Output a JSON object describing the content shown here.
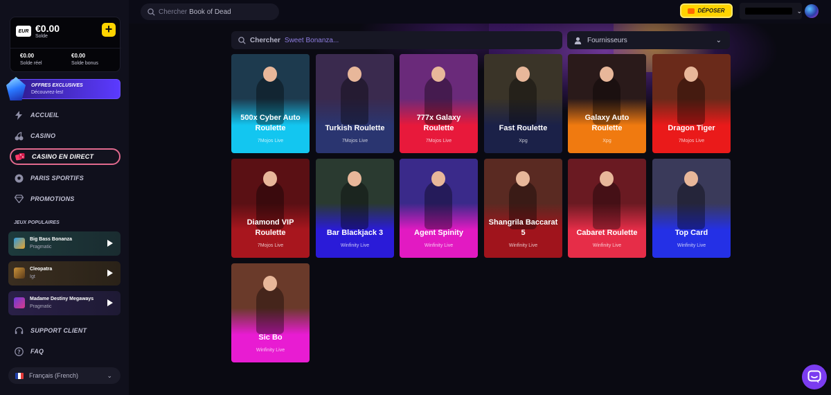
{
  "top": {
    "search_prefix": "Chercher",
    "search_hint": "Book of Dead",
    "deposit_label": "DÉPOSER"
  },
  "balance": {
    "currency": "EUR",
    "amount": "€0.00",
    "label": "Solde",
    "real_value": "€0.00",
    "real_label": "Solde réel",
    "bonus_value": "€0.00",
    "bonus_label": "Solde bonus"
  },
  "promo": {
    "title": "OFFRES EXCLUSIVES",
    "subtitle": "Découvrez-les!"
  },
  "nav": [
    {
      "label": "ACCUEIL",
      "icon": "bolt-icon"
    },
    {
      "label": "CASINO",
      "icon": "cherry-icon"
    },
    {
      "label": "CASINO EN DIRECT",
      "icon": "dice-icon",
      "active": true
    },
    {
      "label": "PARIS SPORTIFS",
      "icon": "soccer-ball-icon"
    },
    {
      "label": "PROMOTIONS",
      "icon": "diamond-icon"
    }
  ],
  "popular": {
    "title": "JEUX POPULAIRES",
    "games": [
      {
        "name": "Big Bass Bonanza",
        "provider": "Pragmatic"
      },
      {
        "name": "Cleopatra",
        "provider": "Igt"
      },
      {
        "name": "Madame Destiny Megaways",
        "provider": "Pragmatic"
      }
    ]
  },
  "support": [
    {
      "label": "SUPPORT CLIENT",
      "icon": "headset-icon"
    },
    {
      "label": "FAQ",
      "icon": "question-icon"
    }
  ],
  "language": "Français (French)",
  "game_search": {
    "prefix": "Chercher",
    "hint": "Sweet Bonanza..."
  },
  "providers_label": "Fournisseurs",
  "games": [
    {
      "name": "500x Cyber Auto Roulette",
      "provider": "7Mojos Live",
      "color": "#13c6f0",
      "art": "#1d3a4e"
    },
    {
      "name": "Turkish Roulette",
      "provider": "7Mojos Live",
      "color": "#2a3570",
      "art": "#3a2a4e"
    },
    {
      "name": "777x Galaxy Roulette",
      "provider": "7Mojos Live",
      "color": "#e8193b",
      "art": "#6a2a7a"
    },
    {
      "name": "Fast Roulette",
      "provider": "Xpg",
      "color": "#1b2148",
      "art": "#3a3428"
    },
    {
      "name": "Galaxy Auto Roulette",
      "provider": "Xpg",
      "color": "#f07a10",
      "art": "#2a1a1a"
    },
    {
      "name": "Dragon Tiger",
      "provider": "7Mojos Live",
      "color": "#ea1a1a",
      "art": "#6a2a1a"
    },
    {
      "name": "Diamond VIP Roulette",
      "provider": "7Mojos Live",
      "color": "#a8161e",
      "art": "#5a1014"
    },
    {
      "name": "Bar Blackjack 3",
      "provider": "Winfinity Live",
      "color": "#2a1bd8",
      "art": "#2a3a30"
    },
    {
      "name": "Agent Spinity",
      "provider": "Winfinity Live",
      "color": "#e21ac2",
      "art": "#3a2a8a"
    },
    {
      "name": "Shangrila Baccarat 5",
      "provider": "Winfinity Live",
      "color": "#a0141c",
      "art": "#5a2a22"
    },
    {
      "name": "Cabaret Roulette",
      "provider": "Winfinity Live",
      "color": "#e62d48",
      "art": "#6a1a22"
    },
    {
      "name": "Top Card",
      "provider": "Winfinity Live",
      "color": "#2430e6",
      "art": "#3a3a5a"
    },
    {
      "name": "Sic Bo",
      "provider": "Winfinity Live",
      "color": "#e81cd2",
      "art": "#6a3a2a"
    }
  ]
}
